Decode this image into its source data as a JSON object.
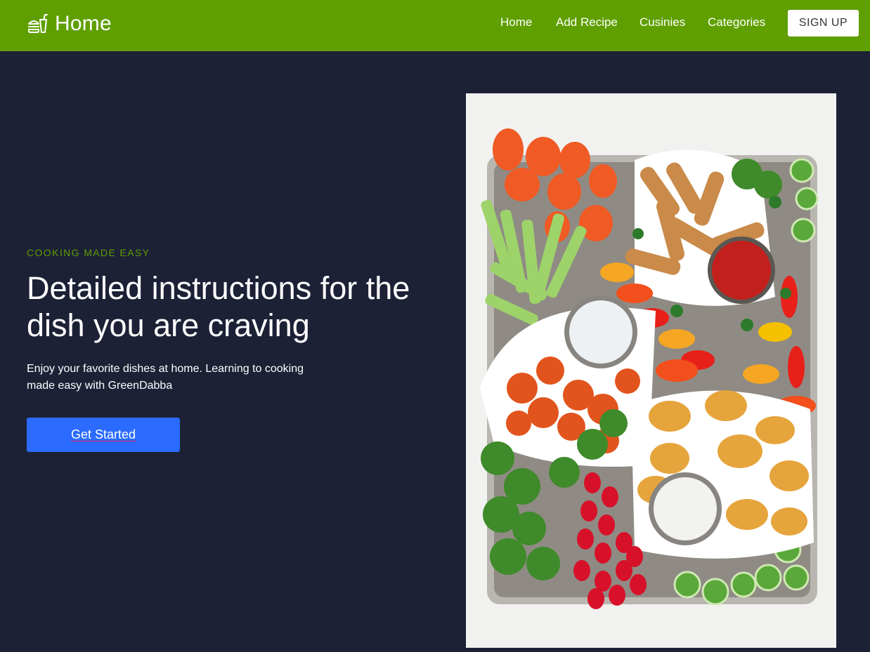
{
  "navbar": {
    "brand": {
      "icon": "burger-drink-icon",
      "title": "Home"
    },
    "links": [
      {
        "label": "Home"
      },
      {
        "label": "Add Recipe"
      },
      {
        "label": "Cusinies"
      },
      {
        "label": "Categories"
      }
    ],
    "signup_label": "SIGN UP"
  },
  "hero": {
    "eyebrow": "COOKING MADE EASY",
    "headline": "Detailed instructions for the dish you are craving",
    "subtext": "Enjoy your favorite dishes at home. Learning to cooking made easy with GreenDabba",
    "cta_label": "Get Started",
    "image": {
      "subject": "party-platter-photo"
    }
  },
  "colors": {
    "nav_background": "#5f9f00",
    "page_background": "#1c2136",
    "accent_green": "#5f9f00",
    "cta_blue": "#2b6bff"
  }
}
